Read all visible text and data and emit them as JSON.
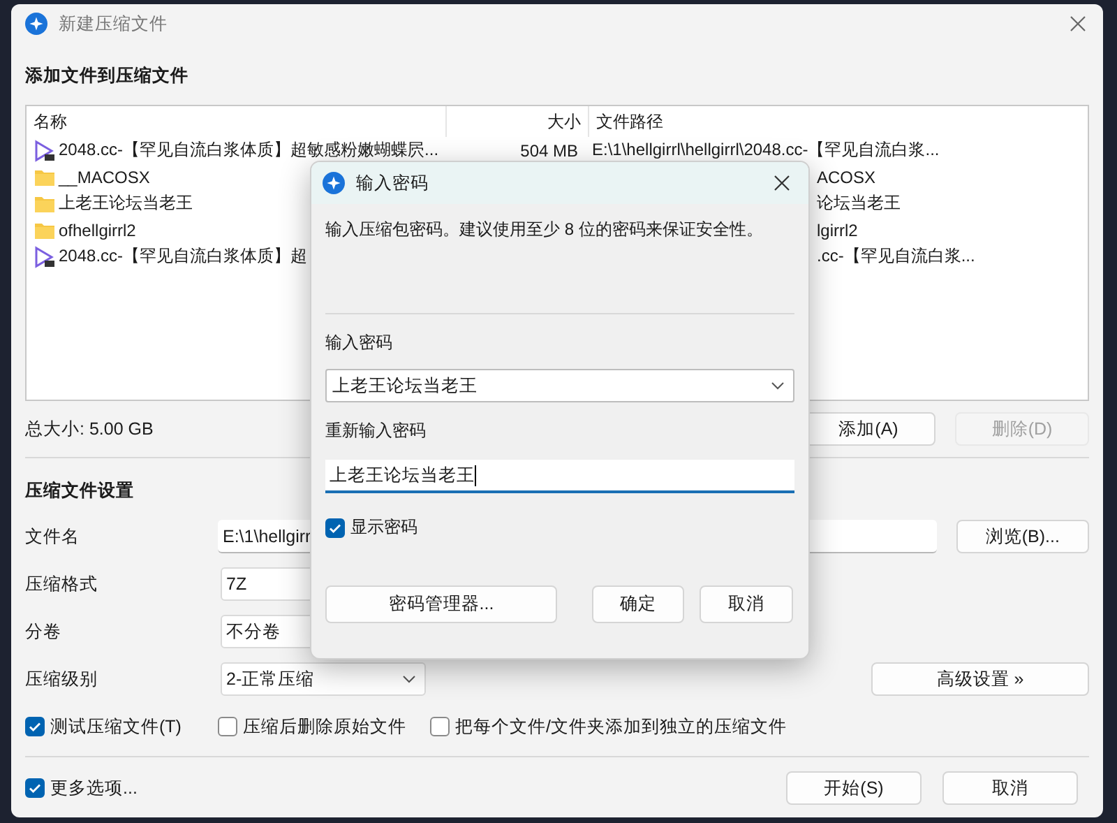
{
  "window": {
    "title": "新建压缩文件"
  },
  "file_section": {
    "heading": "添加文件到压缩文件",
    "columns": [
      "名称",
      "大小",
      "文件路径"
    ],
    "rows": [
      {
        "kind": "video",
        "name": "2048.cc-【罕见自流白浆体质】超敏感粉嫩蝴蝶屄...",
        "size": "504 MB",
        "path": "E:\\1\\hellgirrl\\hellgirrl\\2048.cc-【罕见自流白浆..."
      },
      {
        "kind": "folder",
        "name": "__MACOSX",
        "path": "ACOSX"
      },
      {
        "kind": "folder",
        "name": "上老王论坛当老王",
        "path": "论坛当老王"
      },
      {
        "kind": "folder",
        "name": "ofhellgirrl2",
        "path": "lgirrl2"
      },
      {
        "kind": "video",
        "name": "2048.cc-【罕见自流白浆体质】超",
        "path": ".cc-【罕见自流白浆..."
      }
    ],
    "total": "总大小: 5.00 GB",
    "buttons": [
      {
        "label": "添加(A)",
        "disabled": false
      },
      {
        "label": "删除(D)",
        "disabled": true
      }
    ]
  },
  "settings": {
    "heading": "压缩文件设置",
    "fields": [
      {
        "label": "文件名",
        "kind": "text",
        "value": "E:\\1\\hellgirr"
      },
      {
        "label": "压缩格式",
        "kind": "list",
        "value": "7Z"
      },
      {
        "label": "分卷",
        "kind": "list",
        "value": "不分卷"
      },
      {
        "label": "压缩级别",
        "kind": "dropdown",
        "value": "2-正常压缩"
      }
    ],
    "browse_button": "浏览(B)...",
    "advanced_button": "高级设置 »",
    "options": [
      {
        "label": "测试压缩文件(T)",
        "checked": true
      },
      {
        "label": "压缩后删除原始文件",
        "checked": false
      },
      {
        "label": "把每个文件/文件夹添加到独立的压缩文件",
        "checked": false
      }
    ]
  },
  "more_options": {
    "label": "更多选项...",
    "checked": true
  },
  "footer_buttons": [
    "开始(S)",
    "取消"
  ],
  "password_dialog": {
    "title": "输入密码",
    "description": "输入压缩包密码。建议使用至少 8 位的密码来保证安全性。",
    "password_label": "输入密码",
    "password_value": "上老王论坛当老王",
    "reenter_label": "重新输入密码",
    "reenter_value": "上老王论坛当老王",
    "show_password": {
      "label": "显示密码",
      "checked": true
    },
    "buttons": [
      "密码管理器...",
      "确定",
      "取消"
    ]
  }
}
